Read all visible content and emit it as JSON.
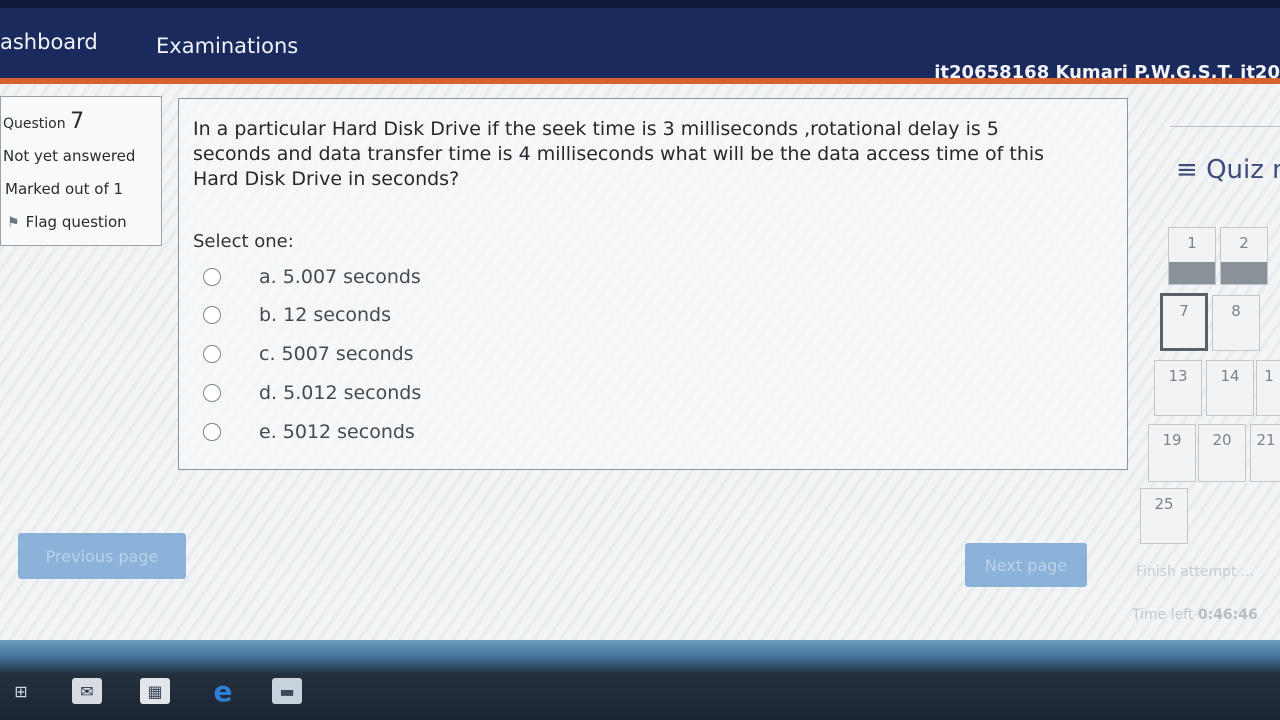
{
  "topbar": {
    "nav_dashboard": "ashboard",
    "nav_examinations": "Examinations",
    "user_label": "it20658168 Kumari P.W.G.S.T. it20"
  },
  "question_info": {
    "question_label": "Question",
    "question_number": "7",
    "state": "Not yet answered",
    "marks": "Marked out of 1",
    "flag_label": "Flag question"
  },
  "question": {
    "text": "In a particular Hard Disk Drive if the seek time is 3 milliseconds ,rotational delay is 5 seconds and data transfer time is 4 milliseconds what will be the data access time of this Hard Disk Drive in seconds?",
    "select_label": "Select one:",
    "options": [
      {
        "label": "a. 5.007 seconds"
      },
      {
        "label": "b. 12 seconds"
      },
      {
        "label": "c. 5007 seconds"
      },
      {
        "label": "d. 5.012 seconds"
      },
      {
        "label": "e. 5012 seconds"
      }
    ]
  },
  "buttons": {
    "previous": "Previous page",
    "next": "Next page"
  },
  "quiz_nav": {
    "title": "Quiz n",
    "items": [
      "1",
      "2",
      "7",
      "8",
      "13",
      "14",
      "1",
      "19",
      "20",
      "21",
      "25"
    ],
    "current": "7",
    "finish_label": "Finish attempt ...",
    "time_left_label": "Time left",
    "time_left_value": "0:46:46"
  },
  "taskbar": {
    "icons": [
      "task-view-icon",
      "mail-icon",
      "store-icon",
      "edge-browser-icon",
      "file-explorer-icon"
    ]
  }
}
